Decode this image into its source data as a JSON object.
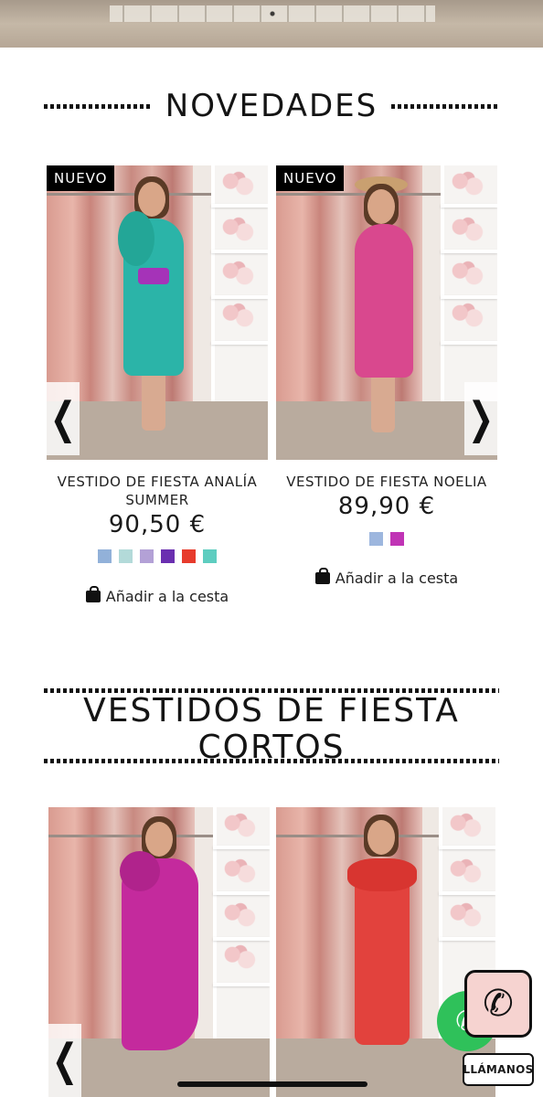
{
  "sections": {
    "new_title": "NOVEDADES",
    "short_title_line1": "VESTIDOS DE FIESTA",
    "short_title_line2": "CORTOS"
  },
  "products_new": [
    {
      "badge": "NUEVO",
      "name_line1": "VESTIDO DE FIESTA ANALÍA",
      "name_line2": "SUMMER",
      "price": "90,50 €",
      "colors": [
        "#92b1d9",
        "#b3dad9",
        "#b3a1d6",
        "#6a2fb0",
        "#e73b2c",
        "#5ecdc0"
      ],
      "add_label": "Añadir a la cesta",
      "dress_color": "#2bb4a8"
    },
    {
      "badge": "NUEVO",
      "name_line1": "VESTIDO DE FIESTA NOELIA",
      "price": "89,90 €",
      "colors": [
        "#9db6de",
        "#c034b5"
      ],
      "add_label": "Añadir a la cesta",
      "dress_color": "#d9488e"
    }
  ],
  "products_short": [
    {
      "dress_color": "#c42a9d"
    },
    {
      "dress_color": "#e2423d"
    }
  ],
  "nav": {
    "prev_glyph": "❮",
    "next_glyph": "❯"
  },
  "contact": {
    "call_label": "LLÁMANOS",
    "phone_glyph": "✆",
    "whatsapp_glyph": "✆"
  }
}
